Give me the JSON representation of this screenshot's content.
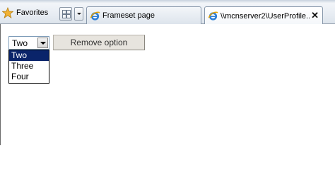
{
  "toolbar": {
    "favorites_label": "Favorites",
    "tabs": [
      {
        "label": "Frameset page",
        "active": false
      },
      {
        "label": "\\\\mcnserver2\\UserProfile...",
        "active": true
      }
    ],
    "close_glyph": "✕"
  },
  "page": {
    "select": {
      "value": "Two",
      "options": [
        "Two",
        "Three",
        "Four"
      ]
    },
    "remove_button_label": "Remove option"
  },
  "icons": {
    "favorites": "star-icon",
    "quick_tabs": "quick-tabs-icon",
    "tab_list": "chevron-down-icon",
    "tab_favicon": "ie-icon",
    "close": "close-icon"
  },
  "colors": {
    "selection": "#0a246a",
    "accent_star": "#f2b233"
  }
}
